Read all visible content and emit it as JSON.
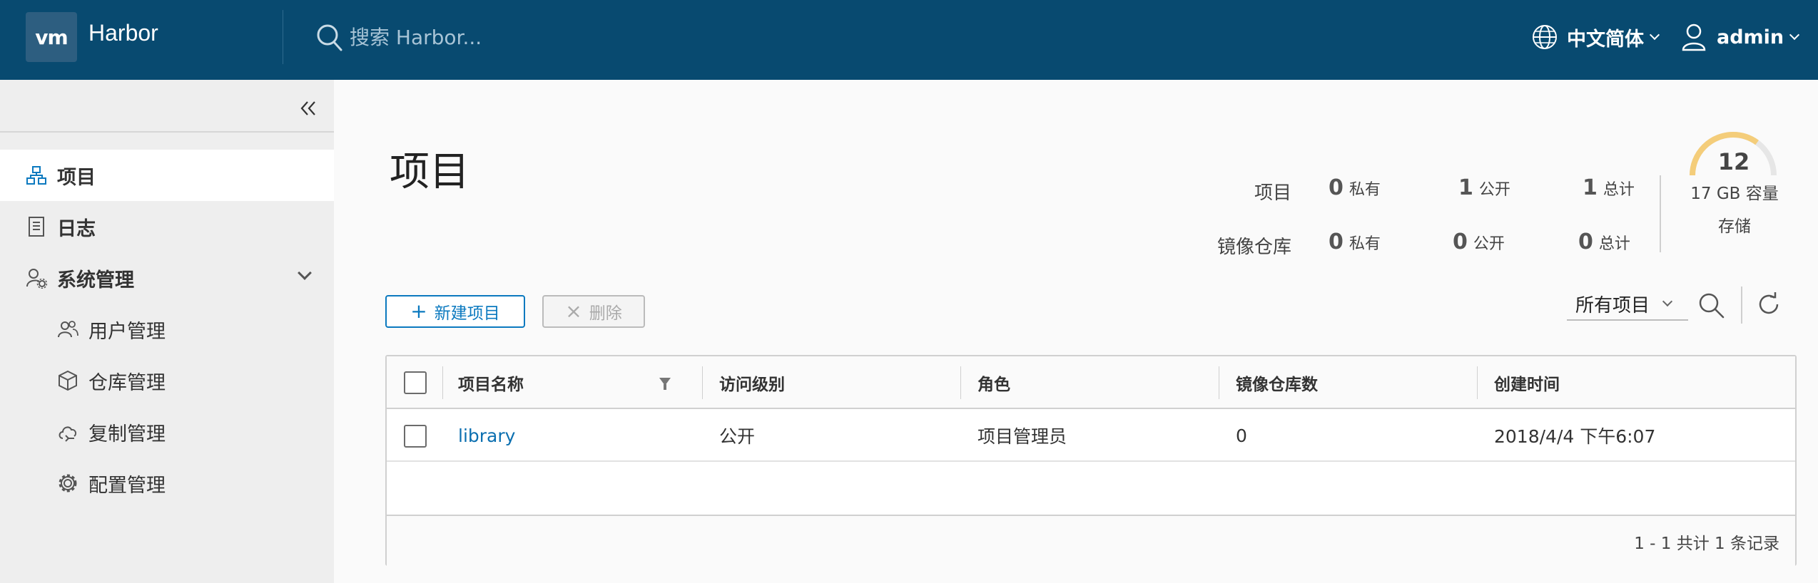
{
  "colors": {
    "header_bg": "#084a70",
    "accent": "#0b79bf",
    "sidebar_bg": "#eeeeee",
    "gauge": "#f4cd7a"
  },
  "header": {
    "logo": "vm",
    "app_name": "Harbor",
    "search_placeholder": "搜索 Harbor...",
    "language": "中文简体",
    "user": "admin",
    "icons": [
      "search-icon",
      "globe-icon",
      "user-icon"
    ]
  },
  "sidebar": {
    "items": [
      {
        "label": "项目",
        "icon": "project-icon",
        "active": true
      },
      {
        "label": "日志",
        "icon": "log-icon"
      },
      {
        "label": "系统管理",
        "icon": "admin-icon",
        "expanded": true
      }
    ],
    "sub_items": [
      {
        "label": "用户管理",
        "icon": "users-icon"
      },
      {
        "label": "仓库管理",
        "icon": "box-icon"
      },
      {
        "label": "复制管理",
        "icon": "cloud-icon"
      },
      {
        "label": "配置管理",
        "icon": "gear-icon"
      }
    ]
  },
  "main": {
    "title": "项目",
    "stats": {
      "projects_label": "项目",
      "repos_label": "镜像仓库",
      "projects": {
        "private": "0",
        "public": "1",
        "total": "1"
      },
      "repos": {
        "private": "0",
        "public": "0",
        "total": "0"
      },
      "private_label": "私有",
      "public_label": "公开",
      "total_label": "总计"
    },
    "quota": {
      "number": "12",
      "capacity": "17 GB 容量",
      "storage": "存储",
      "fraction": 0.7
    }
  },
  "toolbar": {
    "new_project": "新建项目",
    "delete": "删除",
    "filter_selected": "所有项目"
  },
  "table": {
    "columns": [
      "项目名称",
      "访问级别",
      "角色",
      "镜像仓库数",
      "创建时间"
    ],
    "rows": [
      {
        "name": "library",
        "access": "公开",
        "role": "项目管理员",
        "repo_count": "0",
        "created": "2018/4/4 下午6:07"
      }
    ],
    "footer": "1 - 1 共计 1 条记录"
  }
}
